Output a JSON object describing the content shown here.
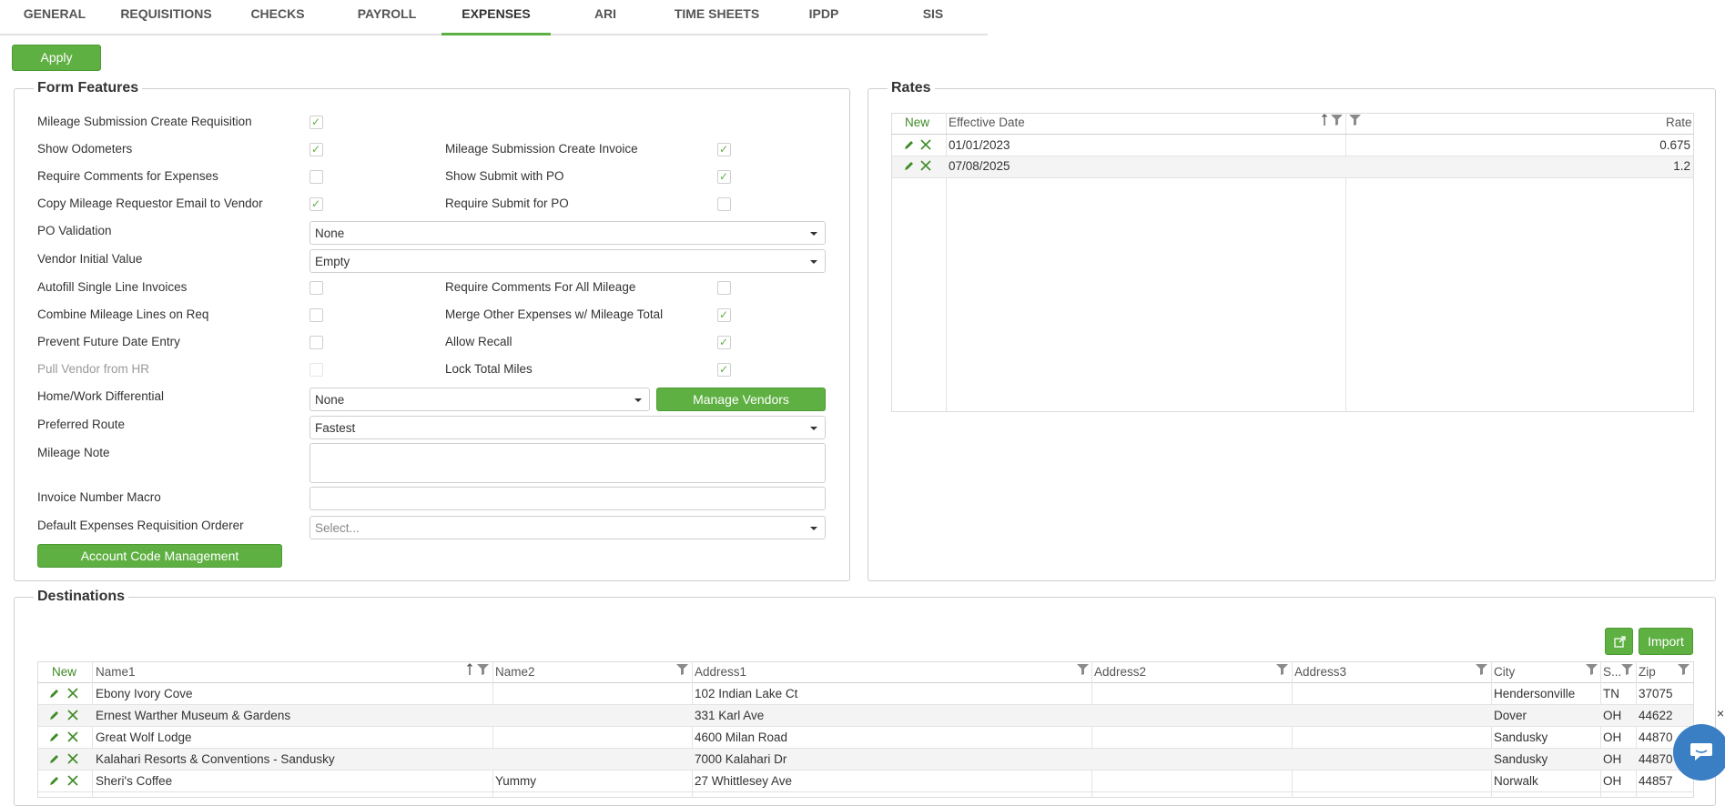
{
  "tabs": [
    "GENERAL",
    "REQUISITIONS",
    "CHECKS",
    "PAYROLL",
    "EXPENSES",
    "ARI",
    "TIME SHEETS",
    "IPDP",
    "SIS"
  ],
  "apply_label": "Apply",
  "form_features": {
    "title": "Form Features",
    "left_checks": [
      {
        "label": "Mileage Submission Create Requisition",
        "checked": true,
        "disabled": false
      },
      {
        "label": "Show Odometers",
        "checked": true,
        "disabled": false
      },
      {
        "label": "Require Comments for Expenses",
        "checked": false,
        "disabled": false
      },
      {
        "label": "Copy Mileage Requestor Email to Vendor",
        "checked": true,
        "disabled": false
      }
    ],
    "right_checks": [
      {
        "label": "Mileage Submission Create Invoice",
        "checked": true
      },
      {
        "label": "Show Submit with PO",
        "checked": true
      },
      {
        "label": "Require Submit for PO",
        "checked": false
      }
    ],
    "po_validation": {
      "label": "PO Validation",
      "value": "None"
    },
    "vendor_initial": {
      "label": "Vendor Initial Value",
      "value": "Empty"
    },
    "left_checks2": [
      {
        "label": "Autofill Single Line Invoices",
        "checked": false,
        "disabled": false
      },
      {
        "label": "Combine Mileage Lines on Req",
        "checked": false,
        "disabled": false
      },
      {
        "label": "Prevent Future Date Entry",
        "checked": false,
        "disabled": false
      },
      {
        "label": "Pull Vendor from HR",
        "checked": false,
        "disabled": true
      }
    ],
    "right_checks2": [
      {
        "label": "Require Comments For All Mileage",
        "checked": false
      },
      {
        "label": "Merge Other Expenses w/ Mileage Total",
        "checked": true
      },
      {
        "label": "Allow Recall",
        "checked": true
      },
      {
        "label": "Lock Total Miles",
        "checked": true
      }
    ],
    "home_work": {
      "label": "Home/Work Differential",
      "value": "None"
    },
    "manage_vendors_label": "Manage Vendors",
    "preferred_route": {
      "label": "Preferred Route",
      "value": "Fastest"
    },
    "mileage_note_label": "Mileage Note",
    "invoice_macro_label": "Invoice Number Macro",
    "default_orderer": {
      "label": "Default Expenses Requisition Orderer",
      "placeholder": "Select..."
    },
    "account_code_label": "Account Code Management"
  },
  "rates": {
    "title": "Rates",
    "new_label": "New",
    "col_date": "Effective Date",
    "col_rate": "Rate",
    "rows": [
      {
        "date": "01/01/2023",
        "rate": "0.675"
      },
      {
        "date": "07/08/2025",
        "rate": "1.2"
      }
    ]
  },
  "destinations": {
    "title": "Destinations",
    "import_label": "Import",
    "new_label": "New",
    "columns": [
      "Name1",
      "Name2",
      "Address1",
      "Address2",
      "Address3",
      "City",
      "S...",
      "Zip"
    ],
    "rows": [
      [
        "Ebony Ivory Cove",
        "",
        "102 Indian Lake Ct",
        "",
        "",
        "Hendersonville",
        "TN",
        "37075"
      ],
      [
        "Ernest Warther Museum & Gardens",
        "",
        "331 Karl Ave",
        "",
        "",
        "Dover",
        "OH",
        "44622"
      ],
      [
        "Great Wolf Lodge",
        "",
        "4600 Milan Road",
        "",
        "",
        "Sandusky",
        "OH",
        "44870"
      ],
      [
        "Kalahari Resorts & Conventions - Sandusky",
        "",
        "7000 Kalahari Dr",
        "",
        "",
        "Sandusky",
        "OH",
        "44870"
      ],
      [
        "Sheri's Coffee",
        "Yummy",
        "27 Whittlesey Ave",
        "",
        "",
        "Norwalk",
        "OH",
        "44857"
      ]
    ]
  },
  "colors": {
    "accent": "#5fb043",
    "chat": "#3a7fc4"
  }
}
